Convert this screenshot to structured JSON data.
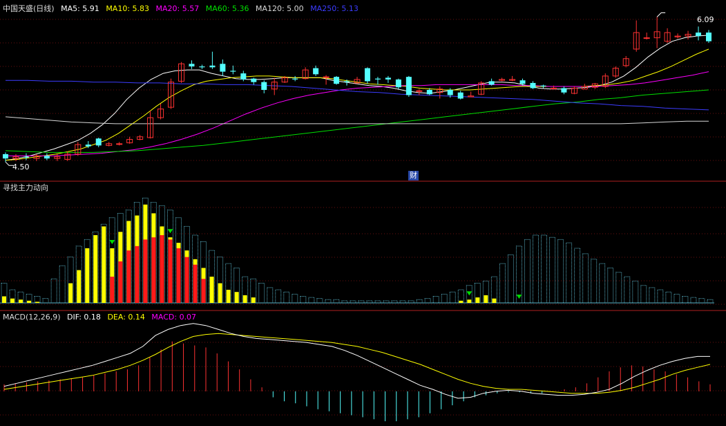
{
  "header_main": {
    "title": "中国天盛(日线)",
    "ma": [
      {
        "label": "MA5: 5.91",
        "color": "#ffffff"
      },
      {
        "label": "MA10: 5.83",
        "color": "#ffff00"
      },
      {
        "label": "MA20: 5.57",
        "color": "#ff00ff"
      },
      {
        "label": "MA60: 5.36",
        "color": "#00e000"
      },
      {
        "label": "MA120: 5.00",
        "color": "#d8d8d8"
      },
      {
        "label": "MA250: 5.13",
        "color": "#3c3cff"
      }
    ]
  },
  "header_indicator": {
    "title": "寻找主力动向"
  },
  "header_macd": {
    "title": "MACD(12,26,9)",
    "dif": "DIF: 0.18",
    "dea": "DEA: 0.14",
    "macd": "MACD: 0.07",
    "colors": {
      "dif": "#ffffff",
      "dea": "#ffff00",
      "macd": "#ff00ff"
    }
  },
  "annotations": {
    "high_label": "6.09",
    "low_label": "4.50",
    "finance_badge": "财"
  },
  "chart_data": {
    "type": "candlestick",
    "candle_count": 69,
    "price_range": [
      4.42,
      6.22
    ],
    "candles": [
      [
        4.62,
        4.57,
        4.64,
        4.53
      ],
      [
        4.57,
        4.59,
        4.62,
        4.54
      ],
      [
        4.59,
        4.58,
        4.63,
        4.55
      ],
      [
        4.57,
        4.6,
        4.62,
        4.54
      ],
      [
        4.6,
        4.57,
        4.63,
        4.55
      ],
      [
        4.57,
        4.59,
        4.62,
        4.54
      ],
      [
        4.56,
        4.62,
        4.65,
        4.54
      ],
      [
        4.62,
        4.73,
        4.76,
        4.6
      ],
      [
        4.73,
        4.71,
        4.77,
        4.69
      ],
      [
        4.8,
        4.72,
        4.81,
        4.7
      ],
      [
        4.72,
        4.74,
        4.76,
        4.71
      ],
      [
        4.74,
        4.74,
        4.76,
        4.72
      ],
      [
        4.75,
        4.79,
        4.82,
        4.74
      ],
      [
        4.79,
        4.82,
        4.84,
        4.78
      ],
      [
        4.81,
        5.04,
        5.12,
        4.8
      ],
      [
        5.04,
        5.14,
        5.2,
        5.02
      ],
      [
        5.16,
        5.45,
        5.49,
        5.14
      ],
      [
        5.46,
        5.66,
        5.68,
        5.44
      ],
      [
        5.66,
        5.63,
        5.7,
        5.6
      ],
      [
        5.63,
        5.62,
        5.65,
        5.6
      ],
      [
        5.64,
        5.62,
        5.8,
        5.6
      ],
      [
        5.66,
        5.57,
        5.71,
        5.52
      ],
      [
        5.58,
        5.57,
        5.64,
        5.54
      ],
      [
        5.55,
        5.48,
        5.58,
        5.46
      ],
      [
        5.49,
        5.45,
        5.5,
        5.42
      ],
      [
        5.45,
        5.36,
        5.47,
        5.32
      ],
      [
        5.37,
        5.45,
        5.5,
        5.3
      ],
      [
        5.45,
        5.5,
        5.52,
        5.44
      ],
      [
        5.49,
        5.48,
        5.52,
        5.46
      ],
      [
        5.49,
        5.59,
        5.62,
        5.48
      ],
      [
        5.61,
        5.54,
        5.64,
        5.52
      ],
      [
        5.51,
        5.51,
        5.53,
        5.42
      ],
      [
        5.51,
        5.43,
        5.52,
        5.42
      ],
      [
        5.46,
        5.45,
        5.48,
        5.41
      ],
      [
        5.44,
        5.48,
        5.51,
        5.43
      ],
      [
        5.61,
        5.46,
        5.62,
        5.43
      ],
      [
        5.49,
        5.48,
        5.51,
        5.42
      ],
      [
        5.5,
        5.48,
        5.52,
        5.44
      ],
      [
        5.48,
        5.39,
        5.49,
        5.37
      ],
      [
        5.51,
        5.3,
        5.52,
        5.28
      ],
      [
        5.35,
        5.35,
        5.37,
        5.3
      ],
      [
        5.36,
        5.31,
        5.38,
        5.3
      ],
      [
        5.33,
        5.37,
        5.4,
        5.26
      ],
      [
        5.36,
        5.3,
        5.38,
        5.27
      ],
      [
        5.33,
        5.26,
        5.35,
        5.25
      ],
      [
        5.28,
        5.29,
        5.34,
        5.29
      ],
      [
        5.31,
        5.44,
        5.46,
        5.3
      ],
      [
        5.46,
        5.42,
        5.49,
        5.41
      ],
      [
        5.47,
        5.48,
        5.5,
        5.46
      ],
      [
        5.47,
        5.48,
        5.52,
        5.46
      ],
      [
        5.47,
        5.43,
        5.49,
        5.41
      ],
      [
        5.44,
        5.38,
        5.46,
        5.37
      ],
      [
        5.41,
        5.4,
        5.42,
        5.38
      ],
      [
        5.38,
        5.38,
        5.41,
        5.37
      ],
      [
        5.38,
        5.33,
        5.4,
        5.31
      ],
      [
        5.32,
        5.38,
        5.4,
        5.31
      ],
      [
        5.37,
        5.4,
        5.43,
        5.37
      ],
      [
        5.39,
        5.43,
        5.44,
        5.37
      ],
      [
        5.4,
        5.52,
        5.55,
        5.38
      ],
      [
        5.52,
        5.61,
        5.63,
        5.5
      ],
      [
        5.64,
        5.72,
        5.75,
        5.62
      ],
      [
        5.83,
        6.02,
        6.16,
        5.8
      ],
      [
        5.96,
        5.96,
        6.02,
        5.94
      ],
      [
        5.96,
        6.03,
        6.2,
        5.84
      ],
      [
        5.92,
        6.02,
        6.07,
        5.9
      ],
      [
        5.97,
        5.98,
        6.01,
        5.95
      ],
      [
        5.98,
        6,
        6.04,
        5.94
      ],
      [
        6.02,
        5.98,
        6.09,
        5.93
      ],
      [
        6.02,
        5.92,
        6.05,
        5.9
      ]
    ],
    "moving_averages": [
      {
        "label": "MA5",
        "color": "#ffffff",
        "values": [
          4.55,
          4.57,
          4.6,
          4.64,
          4.68,
          4.73,
          4.78,
          4.86,
          4.96,
          5.09,
          5.25,
          5.38,
          5.48,
          5.55,
          5.58,
          5.59,
          5.59,
          5.55,
          5.52,
          5.49,
          5.48,
          5.48,
          5.49,
          5.5,
          5.5,
          5.5,
          5.5,
          5.47,
          5.45,
          5.43,
          5.41,
          5.4,
          5.38,
          5.35,
          5.33,
          5.32,
          5.34,
          5.36,
          5.39,
          5.42,
          5.45,
          5.45,
          5.44,
          5.41,
          5.38,
          5.37,
          5.37,
          5.38,
          5.39,
          5.41,
          5.45,
          5.52,
          5.62,
          5.74,
          5.84,
          5.92,
          5.96,
          5.98,
          5.99
        ]
      },
      {
        "label": "MA10",
        "color": "#ffff00",
        "values": [
          4.55,
          4.56,
          4.58,
          4.6,
          4.62,
          4.65,
          4.68,
          4.73,
          4.78,
          4.86,
          4.96,
          5.06,
          5.17,
          5.27,
          5.35,
          5.42,
          5.46,
          5.48,
          5.5,
          5.51,
          5.52,
          5.52,
          5.51,
          5.5,
          5.5,
          5.5,
          5.49,
          5.47,
          5.45,
          5.43,
          5.42,
          5.41,
          5.4,
          5.38,
          5.37,
          5.36,
          5.36,
          5.36,
          5.37,
          5.38,
          5.39,
          5.4,
          5.4,
          5.4,
          5.4,
          5.4,
          5.4,
          5.41,
          5.42,
          5.44,
          5.47,
          5.52,
          5.57,
          5.63,
          5.7,
          5.77,
          5.83
        ]
      },
      {
        "label": "MA20",
        "color": "#ff00ff",
        "values": [
          4.6,
          4.6,
          4.6,
          4.6,
          4.61,
          4.62,
          4.63,
          4.65,
          4.67,
          4.7,
          4.74,
          4.79,
          4.85,
          4.92,
          5,
          5.08,
          5.15,
          5.21,
          5.26,
          5.3,
          5.33,
          5.36,
          5.38,
          5.39,
          5.4,
          5.41,
          5.41,
          5.42,
          5.42,
          5.42,
          5.42,
          5.42,
          5.41,
          5.41,
          5.4,
          5.4,
          5.4,
          5.4,
          5.41,
          5.42,
          5.44,
          5.47,
          5.5,
          5.53,
          5.57
        ]
      },
      {
        "label": "MA60",
        "color": "#00e000",
        "values": [
          4.66,
          4.65,
          4.64,
          4.64,
          4.64,
          4.65,
          4.66,
          4.68,
          4.7,
          4.72,
          4.75,
          4.78,
          4.81,
          4.84,
          4.87,
          4.9,
          4.93,
          4.96,
          4.99,
          5.02,
          5.05,
          5.08,
          5.11,
          5.14,
          5.17,
          5.2,
          5.22,
          5.25,
          5.27,
          5.3,
          5.32,
          5.34,
          5.36
        ]
      },
      {
        "label": "MA120",
        "color": "#d8d8d8",
        "values": [
          5.05,
          5.03,
          5.01,
          4.99,
          4.98,
          4.97,
          4.97,
          4.97,
          4.97,
          4.97,
          4.97,
          4.97,
          4.97,
          4.97,
          4.97,
          4.97,
          4.97,
          4.97,
          4.97,
          4.97,
          4.97,
          4.97,
          4.97,
          4.97,
          4.97,
          4.97,
          4.97,
          4.97,
          4.97,
          4.98,
          4.99,
          5,
          5
        ]
      },
      {
        "label": "MA250",
        "color": "#3c3cff",
        "values": [
          5.47,
          5.47,
          5.46,
          5.46,
          5.45,
          5.45,
          5.44,
          5.44,
          5.43,
          5.43,
          5.42,
          5.42,
          5.41,
          5.4,
          5.38,
          5.36,
          5.34,
          5.33,
          5.31,
          5.3,
          5.29,
          5.28,
          5.27,
          5.26,
          5.25,
          5.23,
          5.21,
          5.2,
          5.18,
          5.17,
          5.15,
          5.14,
          5.13
        ]
      }
    ],
    "indicator": {
      "title": "寻找主力动向",
      "range": [
        0,
        100
      ],
      "total_outline": [
        18,
        12,
        10,
        8,
        6,
        4,
        22,
        34,
        42,
        52,
        58,
        65,
        72,
        78,
        82,
        85,
        92,
        96,
        92,
        89,
        85,
        78,
        70,
        62,
        56,
        48,
        42,
        36,
        32,
        24,
        22,
        18,
        14,
        12,
        10,
        8,
        6,
        5,
        4,
        3,
        3,
        2,
        2,
        2,
        2,
        2,
        2,
        2,
        2,
        2,
        3,
        4,
        6,
        8,
        10,
        12,
        16,
        18,
        20,
        24,
        36,
        44,
        52,
        58,
        62,
        62,
        60,
        58,
        55,
        50,
        45,
        40,
        36,
        32,
        28,
        24,
        20,
        16,
        14,
        12,
        10,
        8,
        6,
        5,
        4,
        3
      ],
      "yellow_bars": [
        6,
        4,
        3,
        2,
        1,
        0,
        0,
        0,
        18,
        30,
        50,
        62,
        70,
        50,
        65,
        75,
        80,
        90,
        82,
        70,
        60,
        55,
        48,
        40,
        32,
        24,
        18,
        12,
        10,
        7,
        5,
        0,
        0,
        0,
        0,
        0,
        0,
        0,
        0,
        0,
        0,
        0,
        0,
        0,
        0,
        0,
        0,
        0,
        0,
        0,
        0,
        0,
        0,
        0,
        0,
        2,
        3,
        5,
        7,
        4,
        0,
        0,
        0,
        0,
        0,
        0,
        0,
        0,
        0,
        0,
        0,
        0,
        0,
        0,
        0,
        0,
        0,
        0,
        0,
        0,
        0,
        0,
        0,
        0,
        0,
        0
      ],
      "red_bars": [
        0,
        0,
        0,
        0,
        0,
        0,
        0,
        0,
        0,
        0,
        0,
        0,
        0,
        24,
        38,
        48,
        52,
        58,
        60,
        62,
        58,
        50,
        42,
        35,
        22,
        0,
        0,
        0,
        0,
        0,
        0,
        0,
        0,
        0,
        0,
        0,
        0,
        0,
        0,
        0,
        0,
        0,
        0,
        0,
        0,
        0,
        0,
        0,
        0,
        0,
        0,
        0,
        0,
        0,
        0,
        0,
        0,
        0,
        0,
        0,
        0,
        0,
        0,
        0,
        0,
        0,
        0,
        0,
        0,
        0,
        0,
        0,
        0,
        0,
        0,
        0,
        0,
        0,
        0,
        0,
        0,
        0,
        0,
        0,
        0,
        0
      ],
      "arrows": [
        13,
        20,
        56,
        62
      ]
    },
    "macd": {
      "title": "MACD(12,26,9)",
      "range": [
        -0.32,
        0.72
      ],
      "dif": [
        0.05,
        0.08,
        0.11,
        0.14,
        0.17,
        0.2,
        0.23,
        0.26,
        0.3,
        0.34,
        0.38,
        0.45,
        0.56,
        0.62,
        0.66,
        0.68,
        0.66,
        0.62,
        0.58,
        0.55,
        0.53,
        0.52,
        0.51,
        0.5,
        0.49,
        0.47,
        0.45,
        0.41,
        0.36,
        0.3,
        0.24,
        0.18,
        0.12,
        0.06,
        0.02,
        -0.03,
        -0.07,
        -0.06,
        -0.02,
        0.0,
        0.01,
        0.0,
        -0.02,
        -0.03,
        -0.04,
        -0.04,
        -0.03,
        -0.01,
        0.02,
        0.08,
        0.15,
        0.21,
        0.26,
        0.3,
        0.33,
        0.35,
        0.35
      ],
      "dea": [
        0.02,
        0.04,
        0.06,
        0.08,
        0.1,
        0.12,
        0.14,
        0.16,
        0.19,
        0.22,
        0.26,
        0.31,
        0.37,
        0.44,
        0.5,
        0.55,
        0.57,
        0.58,
        0.57,
        0.56,
        0.55,
        0.54,
        0.53,
        0.52,
        0.51,
        0.5,
        0.49,
        0.47,
        0.45,
        0.42,
        0.39,
        0.35,
        0.31,
        0.27,
        0.22,
        0.17,
        0.12,
        0.08,
        0.05,
        0.03,
        0.02,
        0.02,
        0.01,
        0.0,
        -0.01,
        -0.02,
        -0.02,
        -0.02,
        -0.01,
        0.01,
        0.04,
        0.08,
        0.12,
        0.17,
        0.21,
        0.24,
        0.27
      ],
      "histogram": [
        0.07,
        0.08,
        0.09,
        0.1,
        0.11,
        0.12,
        0.13,
        0.14,
        0.16,
        0.18,
        0.2,
        0.22,
        0.26,
        0.34,
        0.42,
        0.5,
        0.48,
        0.46,
        0.44,
        0.38,
        0.3,
        0.22,
        0.12,
        0.04,
        -0.06,
        -0.1,
        -0.12,
        -0.15,
        -0.18,
        -0.2,
        -0.22,
        -0.24,
        -0.26,
        -0.28,
        -0.3,
        -0.3,
        -0.28,
        -0.26,
        -0.22,
        -0.18,
        -0.14,
        -0.1,
        -0.06,
        -0.04,
        -0.02,
        -0.01,
        -0.01,
        -0.02,
        -0.02,
        0.0,
        0.02,
        0.04,
        0.08,
        0.14,
        0.2,
        0.24,
        0.26,
        0.25,
        0.22,
        0.2,
        0.17,
        0.14,
        0.1,
        0.07
      ]
    }
  }
}
